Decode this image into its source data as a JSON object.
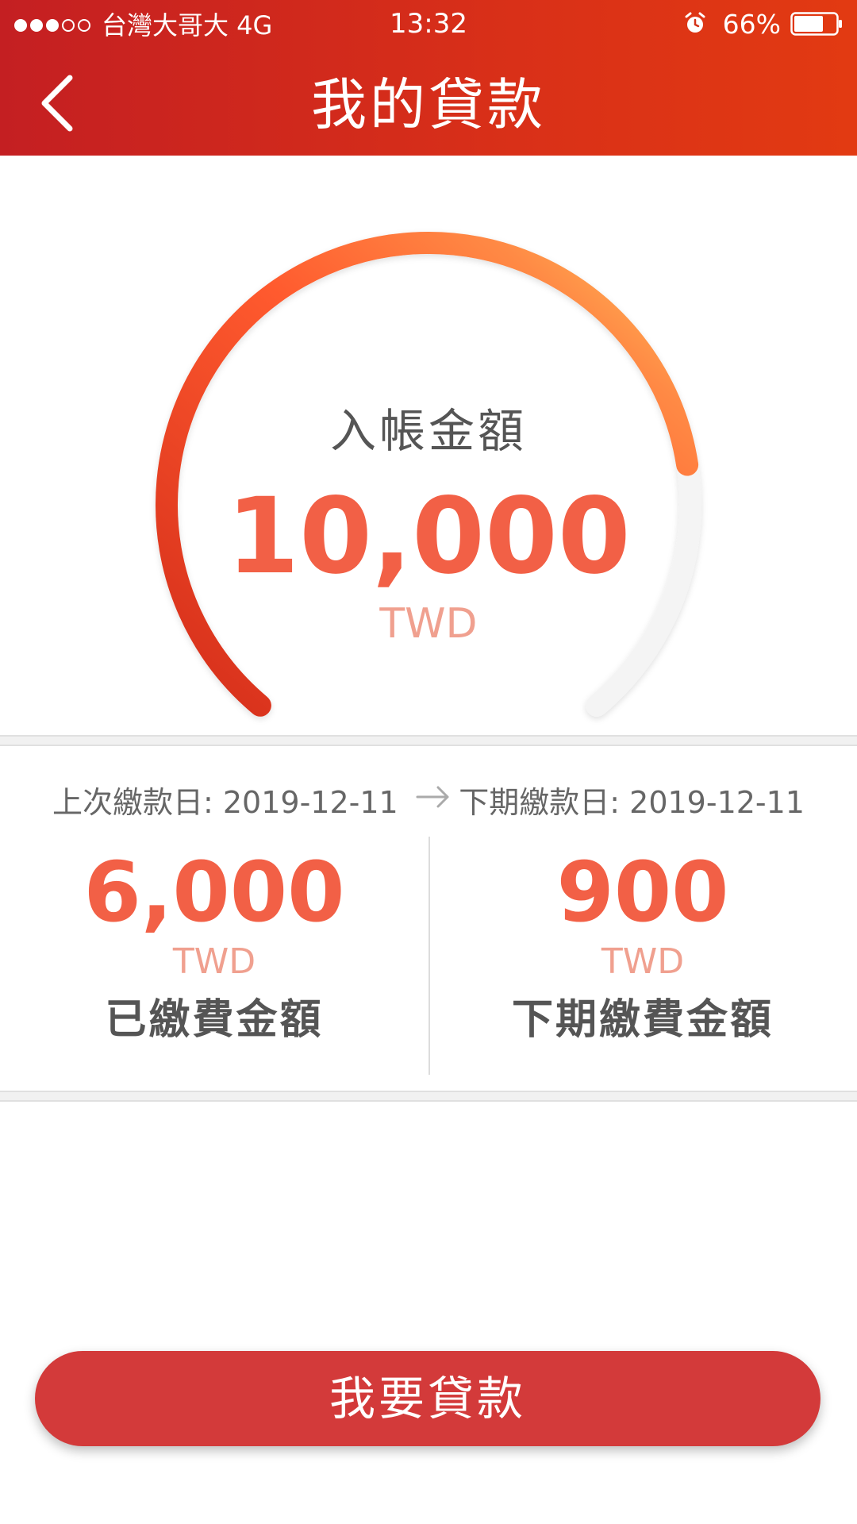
{
  "status_bar": {
    "carrier": "台灣大哥大 4G",
    "time": "13:32",
    "battery": "66%",
    "icons": [
      "signal-dots-icon",
      "alarm-icon",
      "battery-icon"
    ]
  },
  "header": {
    "title": "我的貸款",
    "back_icon": "chevron-left-icon"
  },
  "gauge": {
    "label": "入帳金額",
    "amount": "10,000",
    "currency": "TWD",
    "fill_fraction": 0.79,
    "colors": {
      "start": "#d42d1a",
      "mid": "#ff6a3a",
      "end": "#ffc45a",
      "track": "#f4f4f4"
    }
  },
  "payments": {
    "last_date_text": "上次繳款日: 2019-12-11",
    "next_date_text": "下期繳款日: 2019-12-11",
    "arrow_icon": "arrow-right-icon",
    "paid": {
      "amount": "6,000",
      "currency": "TWD",
      "label": "已繳費金額"
    },
    "next": {
      "amount": "900",
      "currency": "TWD",
      "label": "下期繳費金額"
    }
  },
  "action": {
    "button_label": "我要貸款"
  },
  "colors": {
    "header_start": "#c41f22",
    "header_end": "#e23a12",
    "amount": "#f26046",
    "currency": "#f0a08f",
    "button": "#d33a3a"
  }
}
